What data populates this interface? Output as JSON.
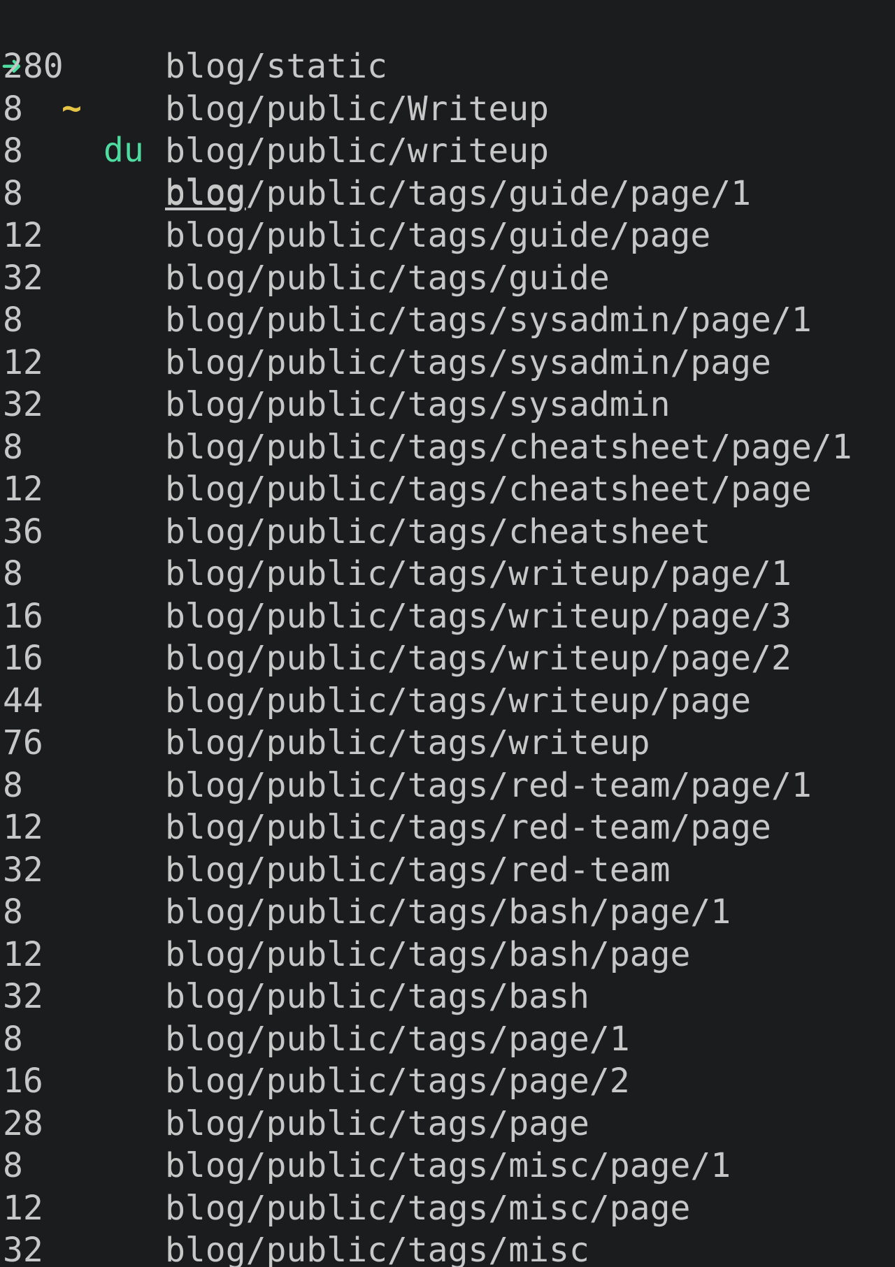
{
  "prompt": {
    "arrow": "➜",
    "cwd": "~",
    "command": "du",
    "argument": "blog"
  },
  "output": [
    {
      "size": "280",
      "path": "blog/static"
    },
    {
      "size": "8",
      "path": "blog/public/Writeup"
    },
    {
      "size": "8",
      "path": "blog/public/writeup"
    },
    {
      "size": "8",
      "path": "blog/public/tags/guide/page/1"
    },
    {
      "size": "12",
      "path": "blog/public/tags/guide/page"
    },
    {
      "size": "32",
      "path": "blog/public/tags/guide"
    },
    {
      "size": "8",
      "path": "blog/public/tags/sysadmin/page/1"
    },
    {
      "size": "12",
      "path": "blog/public/tags/sysadmin/page"
    },
    {
      "size": "32",
      "path": "blog/public/tags/sysadmin"
    },
    {
      "size": "8",
      "path": "blog/public/tags/cheatsheet/page/1"
    },
    {
      "size": "12",
      "path": "blog/public/tags/cheatsheet/page"
    },
    {
      "size": "36",
      "path": "blog/public/tags/cheatsheet"
    },
    {
      "size": "8",
      "path": "blog/public/tags/writeup/page/1"
    },
    {
      "size": "16",
      "path": "blog/public/tags/writeup/page/3"
    },
    {
      "size": "16",
      "path": "blog/public/tags/writeup/page/2"
    },
    {
      "size": "44",
      "path": "blog/public/tags/writeup/page"
    },
    {
      "size": "76",
      "path": "blog/public/tags/writeup"
    },
    {
      "size": "8",
      "path": "blog/public/tags/red-team/page/1"
    },
    {
      "size": "12",
      "path": "blog/public/tags/red-team/page"
    },
    {
      "size": "32",
      "path": "blog/public/tags/red-team"
    },
    {
      "size": "8",
      "path": "blog/public/tags/bash/page/1"
    },
    {
      "size": "12",
      "path": "blog/public/tags/bash/page"
    },
    {
      "size": "32",
      "path": "blog/public/tags/bash"
    },
    {
      "size": "8",
      "path": "blog/public/tags/page/1"
    },
    {
      "size": "16",
      "path": "blog/public/tags/page/2"
    },
    {
      "size": "28",
      "path": "blog/public/tags/page"
    },
    {
      "size": "8",
      "path": "blog/public/tags/misc/page/1"
    },
    {
      "size": "12",
      "path": "blog/public/tags/misc/page"
    },
    {
      "size": "32",
      "path": "blog/public/tags/misc"
    }
  ],
  "colors": {
    "background": "#1b1c1e",
    "text": "#c7c7c7",
    "prompt_arrow": "#4fdca0",
    "prompt_cwd": "#e6c445",
    "command": "#4fdca0"
  }
}
